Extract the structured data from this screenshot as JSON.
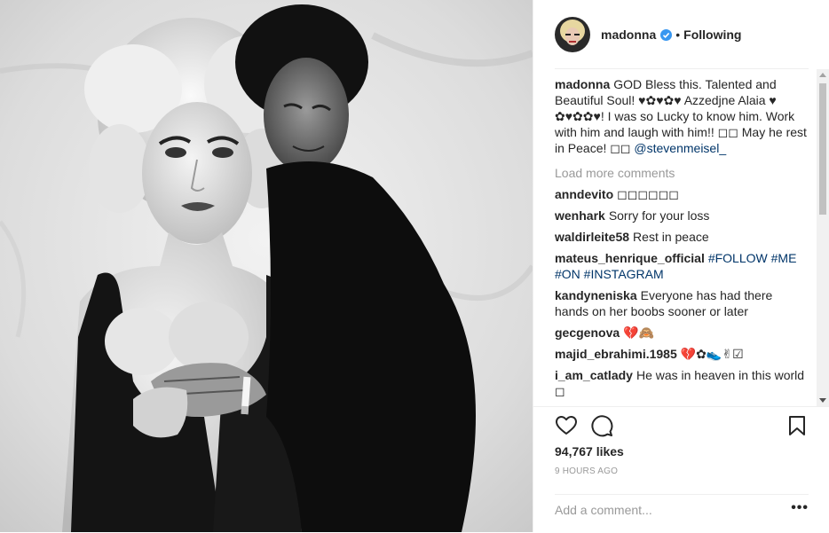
{
  "header": {
    "username": "madonna",
    "status": "Following",
    "separator": "•"
  },
  "caption": {
    "username": "madonna",
    "text": "GOD Bless this. Talented and Beautiful Soul! ♥✿♥✿♥ Azzedjne Alaia ♥ ✿♥✿✿♥! I was so Lucky to know him. Work with him and laugh with him!! ◻◻ May he rest in Peace! ◻◻",
    "mention": "@stevenmeisel_"
  },
  "load_more": "Load more comments",
  "comments": [
    {
      "user": "anndevito",
      "text": "◻◻◻◻◻◻",
      "tag": ""
    },
    {
      "user": "wenhark",
      "text": "Sorry for your loss",
      "tag": ""
    },
    {
      "user": "waldirleite58",
      "text": "Rest in peace",
      "tag": ""
    },
    {
      "user": "mateus_henrique_official",
      "text": "",
      "tag": "#FOLLOW #ME #ON #INSTAGRAM"
    },
    {
      "user": "kandyneniska",
      "text": "Everyone has had there hands on her boobs sooner or later",
      "tag": ""
    },
    {
      "user": "gecgenova",
      "text": "💔🙈",
      "tag": ""
    },
    {
      "user": "majid_ebrahimi.1985",
      "text": "💔✿👟✌☑",
      "tag": ""
    },
    {
      "user": "i_am_catlady",
      "text": "He was in heaven in this world ◻",
      "tag": ""
    }
  ],
  "actions": {
    "icons": [
      "heart-icon",
      "comment-icon",
      "bookmark-icon"
    ]
  },
  "likes": "94,767 likes",
  "timestamp": "9 HOURS AGO",
  "add_comment": {
    "placeholder": "Add a comment...",
    "more_label": "•••"
  },
  "colors": {
    "link": "#003569",
    "muted": "#999999",
    "text": "#262626",
    "verified": "#3897f0"
  }
}
